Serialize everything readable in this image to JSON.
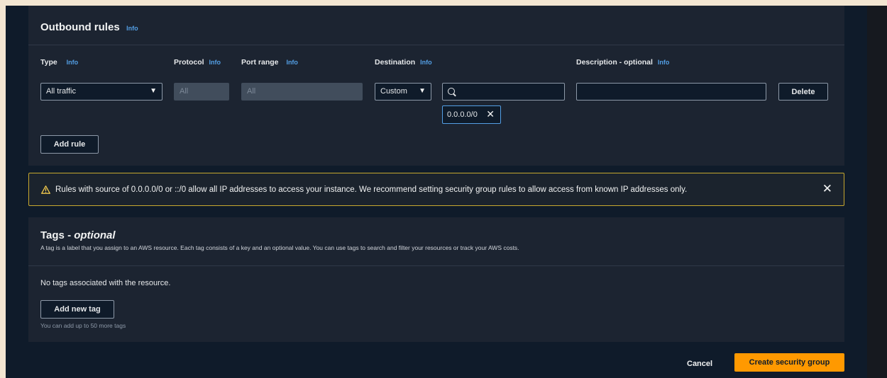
{
  "outbound": {
    "title": "Outbound rules",
    "info": "Info",
    "columns": {
      "type": "Type",
      "protocol": "Protocol",
      "port_range": "Port range",
      "destination": "Destination",
      "description": "Description - optional"
    },
    "rule": {
      "type_value": "All traffic",
      "protocol_value": "All",
      "port_range_value": "All",
      "destination_mode": "Custom",
      "destination_search": "",
      "destination_token": "0.0.0.0/0",
      "description_value": ""
    },
    "delete_label": "Delete",
    "add_rule_label": "Add rule"
  },
  "warning": {
    "text": "Rules with source of 0.0.0.0/0 or ::/0 allow all IP addresses to access your instance. We recommend setting security group rules to allow access from known IP addresses only.",
    "close_icon": "close-icon",
    "color": "#c7a82e"
  },
  "tags": {
    "title": "Tags - ",
    "title_optional": "optional",
    "description": "A tag is a label that you assign to an AWS resource. Each tag consists of a key and an optional value. You can use tags to search and filter your resources or track your AWS costs.",
    "empty_text": "No tags associated with the resource.",
    "add_label": "Add new tag",
    "hint": "You can add up to 50 more tags"
  },
  "footer": {
    "cancel_label": "Cancel",
    "create_label": "Create security group",
    "primary_color": "#ff9900"
  }
}
